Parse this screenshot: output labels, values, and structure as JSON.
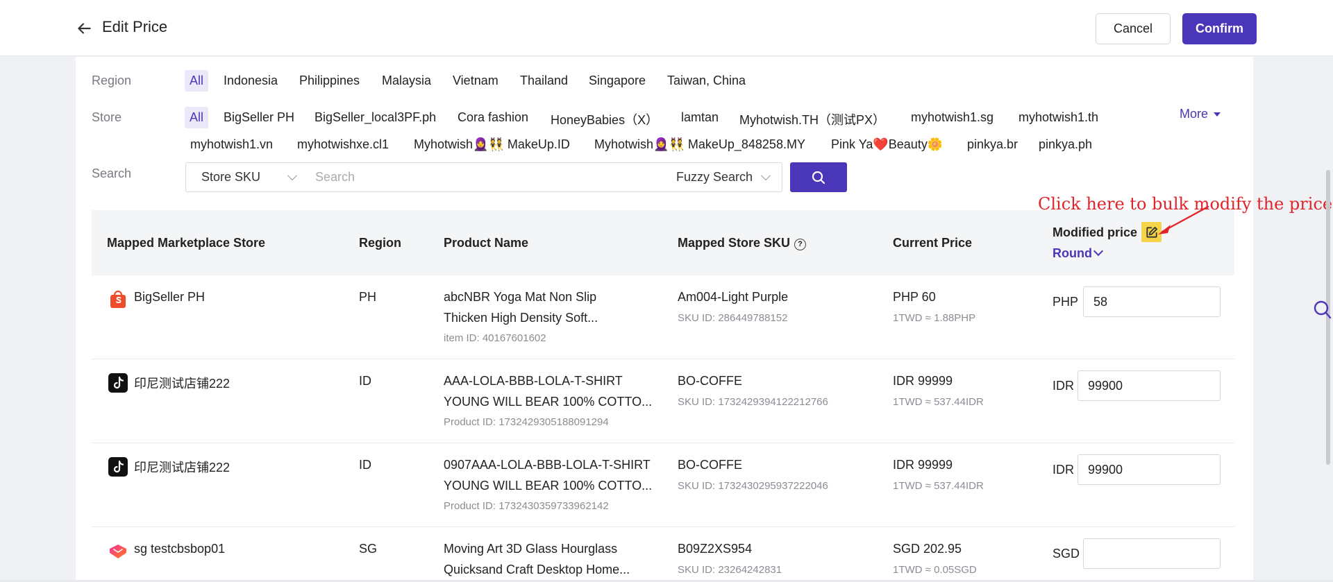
{
  "header": {
    "title": "Edit Price",
    "cancel_label": "Cancel",
    "confirm_label": "Confirm"
  },
  "filters": {
    "region_label": "Region",
    "regions": [
      "All",
      "Indonesia",
      "Philippines",
      "Malaysia",
      "Vietnam",
      "Thailand",
      "Singapore",
      "Taiwan, China"
    ],
    "store_label": "Store",
    "stores_row1": [
      "All",
      "BigSeller PH",
      "BigSeller_local3PF.ph",
      "Cora fashion",
      "HoneyBabies（X）",
      "lamtan",
      "Myhotwish.TH（测试PX）",
      "myhotwish1.sg",
      "myhotwish1.th"
    ],
    "stores_row2": [
      "myhotwish1.vn",
      "myhotwishxe.cl1",
      "Myhotwish🧕👯 MakeUp.ID",
      "Myhotwish🧕👯 MakeUp_848258.MY",
      "Pink Ya❤️Beauty🌼",
      "pinkya.br",
      "pinkya.ph"
    ],
    "more_label": "More",
    "search_label": "Search",
    "search_type": "Store SKU",
    "search_placeholder": "Search",
    "search_mode": "Fuzzy Search"
  },
  "annotation": "Click here to bulk modify the price",
  "table": {
    "columns": {
      "store": "Mapped Marketplace Store",
      "region": "Region",
      "product": "Product Name",
      "sku": "Mapped Store SKU",
      "current": "Current Price",
      "modified": "Modified price",
      "round": "Round"
    },
    "rows": [
      {
        "platform": "shopee",
        "store": "BigSeller PH",
        "region": "PH",
        "product_line1": "abcNBR Yoga Mat Non Slip",
        "product_line2": "Thicken High Density Soft...",
        "product_id": "item ID:   40167601602",
        "sku": "Am004-Light Purple",
        "sku_id": "SKU ID:   286449788152",
        "price": "PHP 60",
        "rate": "1TWD ≈ 1.88PHP",
        "currency": "PHP",
        "modified": "58"
      },
      {
        "platform": "tiktok",
        "store": "印尼测试店铺222",
        "region": "ID",
        "product_line1": "AAA-LOLA-BBB-LOLA-T-SHIRT",
        "product_line2": "YOUNG WILL BEAR 100% COTTO...",
        "product_id": "Product ID:   1732429305188091294",
        "sku": "BO-COFFE",
        "sku_id": "SKU ID:   1732429394122212766",
        "price": "IDR 99999",
        "rate": "1TWD ≈ 537.44IDR",
        "currency": "IDR",
        "modified": "99900"
      },
      {
        "platform": "tiktok",
        "store": "印尼测试店铺222",
        "region": "ID",
        "product_line1": "0907AAA-LOLA-BBB-LOLA-T-SHIRT",
        "product_line2": "YOUNG WILL BEAR 100% COTTO...",
        "product_id": "Product ID:   1732430359733962142",
        "sku": "BO-COFFE",
        "sku_id": "SKU ID:   1732430295937222046",
        "price": "IDR 99999",
        "rate": "1TWD ≈ 537.44IDR",
        "currency": "IDR",
        "modified": "99900"
      },
      {
        "platform": "lazada",
        "store": "sg testcbsbop01",
        "region": "SG",
        "product_line1": "Moving Art 3D Glass Hourglass",
        "product_line2": "Quicksand Craft Desktop Home...",
        "product_id": "",
        "sku": "B09Z2XS954",
        "sku_id": "SKU ID:   23264242831",
        "price": "SGD 202.95",
        "rate": "1TWD ≈ 0.05SGD",
        "currency": "SGD",
        "modified": ""
      }
    ]
  },
  "colors": {
    "accent": "#4a36b8",
    "annotation": "#e0242a",
    "highlight": "#f5d44a"
  }
}
